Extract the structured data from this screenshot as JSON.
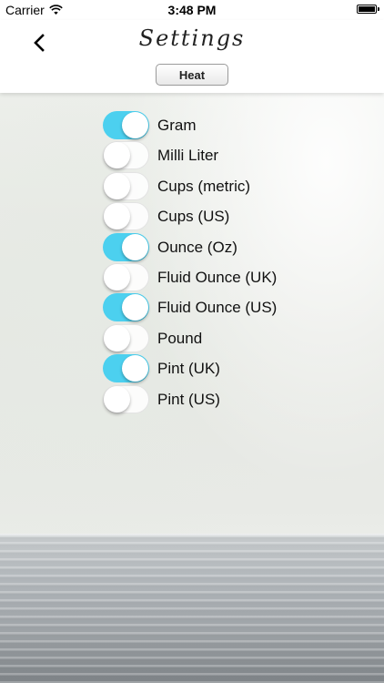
{
  "status_bar": {
    "carrier": "Carrier",
    "time": "3:48 PM"
  },
  "header": {
    "title": "Settings",
    "heat_button": "Heat",
    "back_icon": "chevron-left-icon"
  },
  "options": [
    {
      "label": "Gram",
      "on": true
    },
    {
      "label": "Milli Liter",
      "on": false
    },
    {
      "label": "Cups (metric)",
      "on": false
    },
    {
      "label": "Cups (US)",
      "on": false
    },
    {
      "label": "Ounce (Oz)",
      "on": true
    },
    {
      "label": "Fluid Ounce (UK)",
      "on": false
    },
    {
      "label": "Fluid Ounce (US)",
      "on": true
    },
    {
      "label": "Pound",
      "on": false
    },
    {
      "label": "Pint (UK)",
      "on": true
    },
    {
      "label": "Pint (US)",
      "on": false
    }
  ],
  "colors": {
    "switch_on": "#4cd0ef"
  }
}
